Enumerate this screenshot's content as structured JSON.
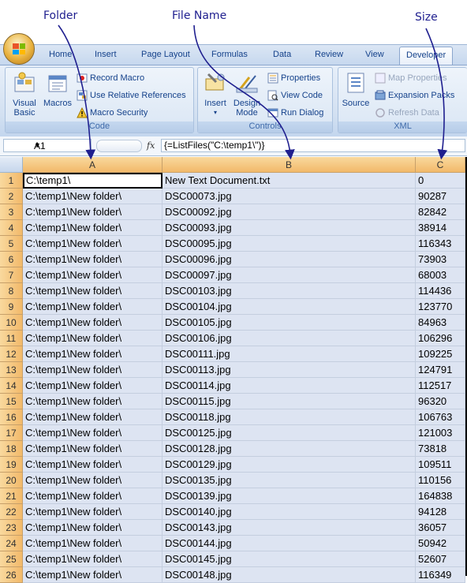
{
  "annotations": {
    "folder": "Folder",
    "file_name": "File Name",
    "size": "Size"
  },
  "ribbon": {
    "tabs": [
      "Home",
      "Insert",
      "Page Layout",
      "Formulas",
      "Data",
      "Review",
      "View",
      "Developer"
    ],
    "active_tab": "Developer",
    "groups": {
      "code": {
        "label": "Code",
        "visual_basic": "Visual Basic",
        "macros": "Macros",
        "record_macro": "Record Macro",
        "use_relative": "Use Relative References",
        "macro_security": "Macro Security"
      },
      "controls": {
        "label": "Controls",
        "insert": "Insert",
        "design_mode": "Design Mode",
        "properties": "Properties",
        "view_code": "View Code",
        "run_dialog": "Run Dialog"
      },
      "xml": {
        "label": "XML",
        "source": "Source",
        "map_properties": "Map Properties",
        "expansion_packs": "Expansion Packs",
        "refresh_data": "Refresh Data"
      }
    }
  },
  "formula_bar": {
    "name_box": "A1",
    "fx": "fx",
    "formula": "{=ListFiles(\"C:\\temp1\\\")}"
  },
  "grid": {
    "columns": [
      "A",
      "B",
      "C"
    ],
    "rows": [
      [
        "1",
        "C:\\temp1\\",
        "New Text Document.txt",
        "0"
      ],
      [
        "2",
        "C:\\temp1\\New folder\\",
        "DSC00073.jpg",
        "90287"
      ],
      [
        "3",
        "C:\\temp1\\New folder\\",
        "DSC00092.jpg",
        "82842"
      ],
      [
        "4",
        "C:\\temp1\\New folder\\",
        "DSC00093.jpg",
        "38914"
      ],
      [
        "5",
        "C:\\temp1\\New folder\\",
        "DSC00095.jpg",
        "116343"
      ],
      [
        "6",
        "C:\\temp1\\New folder\\",
        "DSC00096.jpg",
        "73903"
      ],
      [
        "7",
        "C:\\temp1\\New folder\\",
        "DSC00097.jpg",
        "68003"
      ],
      [
        "8",
        "C:\\temp1\\New folder\\",
        "DSC00103.jpg",
        "114436"
      ],
      [
        "9",
        "C:\\temp1\\New folder\\",
        "DSC00104.jpg",
        "123770"
      ],
      [
        "10",
        "C:\\temp1\\New folder\\",
        "DSC00105.jpg",
        "84963"
      ],
      [
        "11",
        "C:\\temp1\\New folder\\",
        "DSC00106.jpg",
        "106296"
      ],
      [
        "12",
        "C:\\temp1\\New folder\\",
        "DSC00111.jpg",
        "109225"
      ],
      [
        "13",
        "C:\\temp1\\New folder\\",
        "DSC00113.jpg",
        "124791"
      ],
      [
        "14",
        "C:\\temp1\\New folder\\",
        "DSC00114.jpg",
        "112517"
      ],
      [
        "15",
        "C:\\temp1\\New folder\\",
        "DSC00115.jpg",
        "96320"
      ],
      [
        "16",
        "C:\\temp1\\New folder\\",
        "DSC00118.jpg",
        "106763"
      ],
      [
        "17",
        "C:\\temp1\\New folder\\",
        "DSC00125.jpg",
        "121003"
      ],
      [
        "18",
        "C:\\temp1\\New folder\\",
        "DSC00128.jpg",
        "73818"
      ],
      [
        "19",
        "C:\\temp1\\New folder\\",
        "DSC00129.jpg",
        "109511"
      ],
      [
        "20",
        "C:\\temp1\\New folder\\",
        "DSC00135.jpg",
        "110156"
      ],
      [
        "21",
        "C:\\temp1\\New folder\\",
        "DSC00139.jpg",
        "164838"
      ],
      [
        "22",
        "C:\\temp1\\New folder\\",
        "DSC00140.jpg",
        "94128"
      ],
      [
        "23",
        "C:\\temp1\\New folder\\",
        "DSC00143.jpg",
        "36057"
      ],
      [
        "24",
        "C:\\temp1\\New folder\\",
        "DSC00144.jpg",
        "50942"
      ],
      [
        "25",
        "C:\\temp1\\New folder\\",
        "DSC00145.jpg",
        "52607"
      ],
      [
        "26",
        "C:\\temp1\\New folder\\",
        "DSC00148.jpg",
        "116349"
      ]
    ]
  }
}
